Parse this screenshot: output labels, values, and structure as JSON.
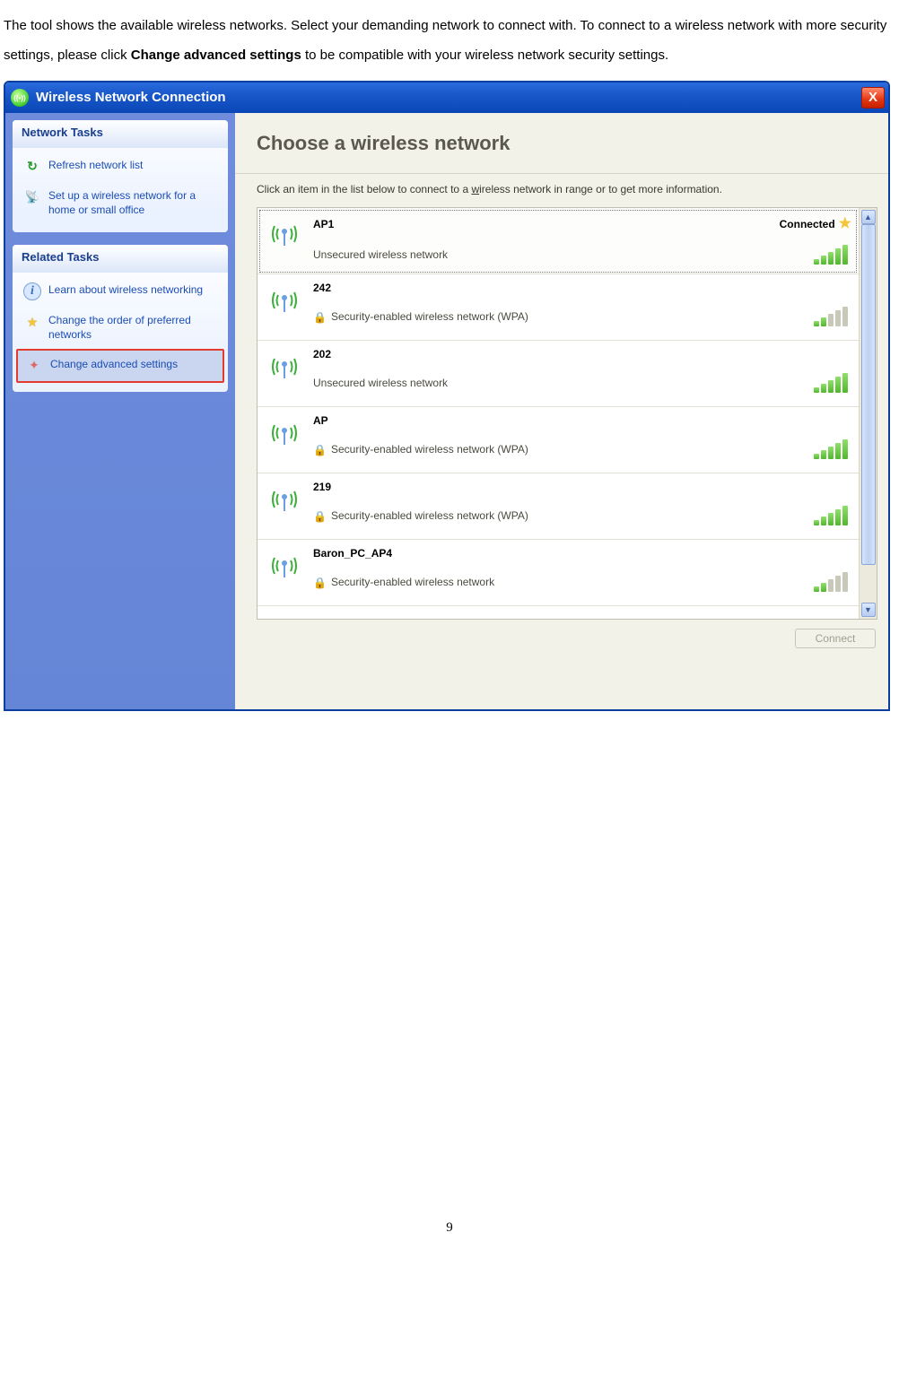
{
  "intro": {
    "part1": "The tool shows the available wireless networks. Select your demanding network to connect with. To connect to a wireless network with more security settings, please click ",
    "bold1": "Change advanced settings",
    "part2": " to be compatible with your wireless network security settings."
  },
  "window": {
    "title": "Wireless Network Connection",
    "close": "X"
  },
  "sidebar": {
    "panel1": {
      "title": "Network Tasks",
      "refresh": "Refresh network list",
      "setup": "Set up a wireless network for a home or small office"
    },
    "panel2": {
      "title": "Related Tasks",
      "learn": "Learn about wireless networking",
      "order": "Change the order of preferred networks",
      "advanced": "Change advanced settings"
    }
  },
  "main": {
    "heading": "Choose a wireless network",
    "sub_pre": "Click an item in the list below to connect to a ",
    "sub_u": "w",
    "sub_post": "ireless network in range or to get more information.",
    "connected_label": "Connected",
    "connect_btn": "Connect"
  },
  "networks": [
    {
      "ssid": "AP1",
      "security": "Unsecured wireless network",
      "locked": false,
      "signal": 5,
      "connected": true,
      "selected": true
    },
    {
      "ssid": "242",
      "security": "Security-enabled wireless network (WPA)",
      "locked": true,
      "signal": 2,
      "connected": false,
      "selected": false
    },
    {
      "ssid": "202",
      "security": "Unsecured wireless network",
      "locked": false,
      "signal": 5,
      "connected": false,
      "selected": false
    },
    {
      "ssid": "AP",
      "security": "Security-enabled wireless network (WPA)",
      "locked": true,
      "signal": 5,
      "connected": false,
      "selected": false
    },
    {
      "ssid": "219",
      "security": "Security-enabled wireless network (WPA)",
      "locked": true,
      "signal": 5,
      "connected": false,
      "selected": false
    },
    {
      "ssid": "Baron_PC_AP4",
      "security": "Security-enabled wireless network",
      "locked": true,
      "signal": 2,
      "connected": false,
      "selected": false
    }
  ],
  "page_number": "9"
}
